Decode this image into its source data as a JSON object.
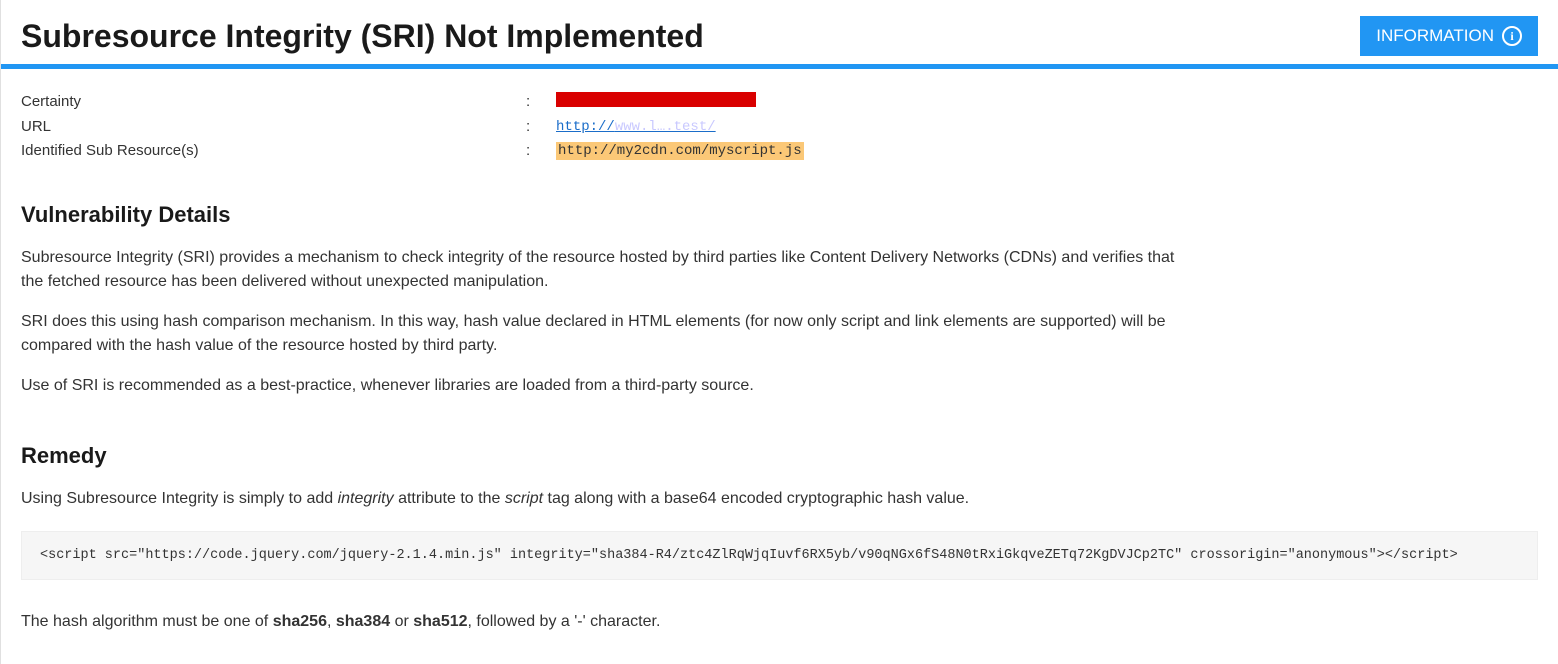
{
  "header": {
    "title": "Subresource Integrity (SRI) Not Implemented",
    "badge_label": "INFORMATION"
  },
  "meta": {
    "certainty_label": "Certainty",
    "url_label": "URL",
    "url_prefix": "http://",
    "url_rest": "www.l….test/",
    "subres_label": "Identified Sub Resource(s)",
    "subres_value": "http://my2cdn.com/myscript.js"
  },
  "vuln": {
    "heading": "Vulnerability Details",
    "p1": "Subresource Integrity (SRI) provides a mechanism to check integrity of the resource hosted by third parties like Content Delivery Networks (CDNs) and verifies that the fetched resource has been delivered without unexpected manipulation.",
    "p2": "SRI does this using hash comparison mechanism. In this way, hash value declared in HTML elements (for now only script and link elements are supported) will be compared with the hash value of the resource hosted by third party.",
    "p3": "Use of SRI is recommended as a best-practice, whenever libraries are loaded from a third-party source."
  },
  "remedy": {
    "heading": "Remedy",
    "text_pre": "Using Subresource Integrity is simply to add ",
    "integrity_word": "integrity",
    "text_mid": " attribute to the ",
    "script_word": "script",
    "text_post": " tag along with a base64 encoded cryptographic hash value.",
    "code": "<script src=\"https://code.jquery.com/jquery-2.1.4.min.js\" integrity=\"sha384-R4/ztc4ZlRqWjqIuvf6RX5yb/v90qNGx6fS48N0tRxiGkqveZETq72KgDVJCp2TC\" crossorigin=\"anonymous\"></script>",
    "hash_pre": "The hash algorithm must be one of ",
    "hash1": "sha256",
    "hash_sep1": ", ",
    "hash2": "sha384",
    "hash_sep2": " or ",
    "hash3": "sha512",
    "hash_post": ", followed by a '-' character."
  }
}
